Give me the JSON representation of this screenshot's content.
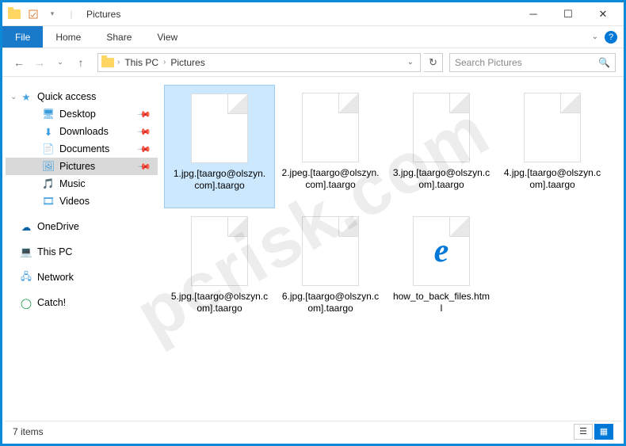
{
  "title": "Pictures",
  "ribbon": {
    "file": "File",
    "tabs": [
      "Home",
      "Share",
      "View"
    ]
  },
  "breadcrumb": [
    "This PC",
    "Pictures"
  ],
  "search_placeholder": "Search Pictures",
  "sidebar": {
    "quick_access": "Quick access",
    "items": [
      {
        "label": "Desktop",
        "pinned": true
      },
      {
        "label": "Downloads",
        "pinned": true
      },
      {
        "label": "Documents",
        "pinned": true
      },
      {
        "label": "Pictures",
        "pinned": true,
        "selected": true
      },
      {
        "label": "Music",
        "pinned": false
      },
      {
        "label": "Videos",
        "pinned": false
      }
    ],
    "onedrive": "OneDrive",
    "thispc": "This PC",
    "network": "Network",
    "catch": "Catch!"
  },
  "files": [
    {
      "name": "1.jpg.[taargo@olszyn.com].taargo",
      "icon": "blank",
      "selected": true
    },
    {
      "name": "2.jpeg.[taargo@olszyn.com].taargo",
      "icon": "blank"
    },
    {
      "name": "3.jpg.[taargo@olszyn.com].taargo",
      "icon": "blank"
    },
    {
      "name": "4.jpg.[taargo@olszyn.com].taargo",
      "icon": "blank"
    },
    {
      "name": "5.jpg.[taargo@olszyn.com].taargo",
      "icon": "blank"
    },
    {
      "name": "6.jpg.[taargo@olszyn.com].taargo",
      "icon": "blank"
    },
    {
      "name": "how_to_back_files.html",
      "icon": "edge"
    }
  ],
  "status": "7 items",
  "watermark": "pcrisk.com"
}
